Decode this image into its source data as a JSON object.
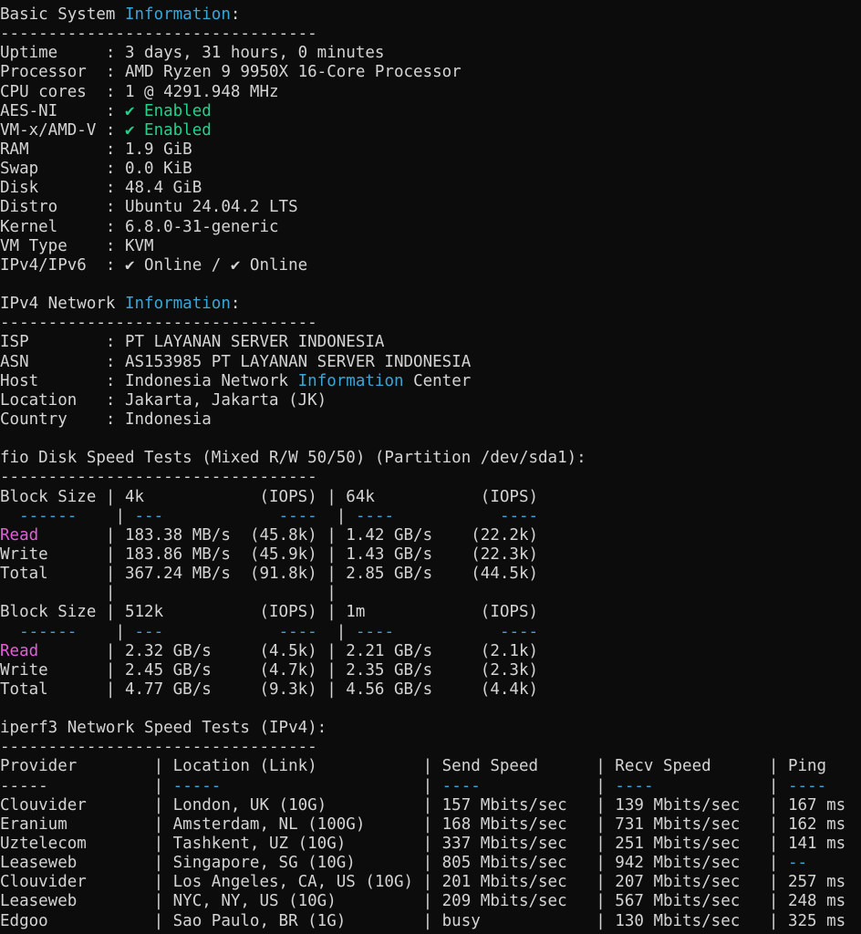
{
  "terminal": {
    "lines": [
      [
        [
          "Basic System ",
          "def"
        ],
        [
          "Information",
          "cyan"
        ],
        [
          ":",
          "def"
        ]
      ],
      [
        [
          "---------------------------------",
          "def"
        ]
      ],
      [
        [
          "Uptime     : 3 days, 31 hours, 0 minutes",
          "def"
        ]
      ],
      [
        [
          "Processor  : AMD Ryzen 9 9950X 16-Core Processor",
          "def"
        ]
      ],
      [
        [
          "CPU cores  : 1 @ 4291.948 MHz",
          "def"
        ]
      ],
      [
        [
          "AES-NI     : ",
          "def"
        ],
        [
          "✔ Enabled",
          "green"
        ]
      ],
      [
        [
          "VM-x/AMD-V : ",
          "def"
        ],
        [
          "✔ Enabled",
          "green"
        ]
      ],
      [
        [
          "RAM        : 1.9 GiB",
          "def"
        ]
      ],
      [
        [
          "Swap       : 0.0 KiB",
          "def"
        ]
      ],
      [
        [
          "Disk       : 48.4 GiB",
          "def"
        ]
      ],
      [
        [
          "Distro     : Ubuntu 24.04.2 LTS",
          "def"
        ]
      ],
      [
        [
          "Kernel     : 6.8.0-31-generic",
          "def"
        ]
      ],
      [
        [
          "VM Type    : KVM",
          "def"
        ]
      ],
      [
        [
          "IPv4/IPv6  : ✔ Online / ✔ Online",
          "def"
        ]
      ],
      [
        [
          "",
          "def"
        ]
      ],
      [
        [
          "IPv4 Network ",
          "def"
        ],
        [
          "Information",
          "cyan"
        ],
        [
          ":",
          "def"
        ]
      ],
      [
        [
          "---------------------------------",
          "def"
        ]
      ],
      [
        [
          "ISP        : PT LAYANAN SERVER INDONESIA",
          "def"
        ]
      ],
      [
        [
          "ASN        : AS153985 PT LAYANAN SERVER INDONESIA",
          "def"
        ]
      ],
      [
        [
          "Host       : Indonesia Network ",
          "def"
        ],
        [
          "Information",
          "cyan"
        ],
        [
          " Center",
          "def"
        ]
      ],
      [
        [
          "Location   : Jakarta, Jakarta (JK)",
          "def"
        ]
      ],
      [
        [
          "Country    : Indonesia",
          "def"
        ]
      ],
      [
        [
          "",
          "def"
        ]
      ],
      [
        [
          "fio Disk Speed Tests (Mixed R/W 50/50) (Partition /dev/sda1):",
          "def"
        ]
      ],
      [
        [
          "---------------------------------",
          "def"
        ]
      ],
      [
        [
          "Block Size | 4k            (IOPS) | 64k           (IOPS)",
          "def"
        ]
      ],
      [
        [
          "  ",
          "def"
        ],
        [
          "------",
          "cyan"
        ],
        [
          "    | ",
          "def"
        ],
        [
          "---",
          "cyan"
        ],
        [
          "            ",
          "def"
        ],
        [
          "----",
          "cyan"
        ],
        [
          "  | ",
          "def"
        ],
        [
          "----",
          "cyan"
        ],
        [
          "           ",
          "def"
        ],
        [
          "----",
          "cyan"
        ]
      ],
      [
        [
          "Read",
          "magenta"
        ],
        [
          "       | 183.38 MB/s  (45.8k) | 1.42 GB/s    (22.2k)",
          "def"
        ]
      ],
      [
        [
          "Write      | 183.86 MB/s  (45.9k) | 1.43 GB/s    (22.3k)",
          "def"
        ]
      ],
      [
        [
          "Total      | 367.24 MB/s  (91.8k) | 2.85 GB/s    (44.5k)",
          "def"
        ]
      ],
      [
        [
          "           |                      |",
          "def"
        ]
      ],
      [
        [
          "Block Size | 512k          (IOPS) | 1m            (IOPS)",
          "def"
        ]
      ],
      [
        [
          "  ",
          "def"
        ],
        [
          "------",
          "cyan"
        ],
        [
          "    | ",
          "def"
        ],
        [
          "---",
          "cyan"
        ],
        [
          "            ",
          "def"
        ],
        [
          "----",
          "cyan"
        ],
        [
          "  | ",
          "def"
        ],
        [
          "----",
          "cyan"
        ],
        [
          "           ",
          "def"
        ],
        [
          "----",
          "cyan"
        ]
      ],
      [
        [
          "Read",
          "magenta"
        ],
        [
          "       | 2.32 GB/s     (4.5k) | 2.21 GB/s     (2.1k)",
          "def"
        ]
      ],
      [
        [
          "Write      | 2.45 GB/s     (4.7k) | 2.35 GB/s     (2.3k)",
          "def"
        ]
      ],
      [
        [
          "Total      | 4.77 GB/s     (9.3k) | 4.56 GB/s     (4.4k)",
          "def"
        ]
      ],
      [
        [
          "",
          "def"
        ]
      ],
      [
        [
          "iperf3 Network Speed Tests (IPv4):",
          "def"
        ]
      ],
      [
        [
          "---------------------------------",
          "def"
        ]
      ],
      [
        [
          "Provider        | Location (Link)           | Send Speed      | Recv Speed      | Ping",
          "def"
        ]
      ],
      [
        [
          "-----           | ",
          "def"
        ],
        [
          "-----",
          "cyan"
        ],
        [
          "                     | ",
          "def"
        ],
        [
          "----",
          "cyan"
        ],
        [
          "            | ",
          "def"
        ],
        [
          "----",
          "cyan"
        ],
        [
          "            | ",
          "def"
        ],
        [
          "----",
          "cyan"
        ]
      ],
      [
        [
          "Clouvider       | London, UK (10G)          | 157 Mbits/sec   | 139 Mbits/sec   | 167 ms",
          "def"
        ]
      ],
      [
        [
          "Eranium         | Amsterdam, NL (100G)      | 168 Mbits/sec   | 731 Mbits/sec   | 162 ms",
          "def"
        ]
      ],
      [
        [
          "Uztelecom       | Tashkent, UZ (10G)        | 337 Mbits/sec   | 251 Mbits/sec   | 141 ms",
          "def"
        ]
      ],
      [
        [
          "Leaseweb        | Singapore, SG (10G)       | 805 Mbits/sec   | 942 Mbits/sec   | ",
          "def"
        ],
        [
          "--",
          "cyan"
        ]
      ],
      [
        [
          "Clouvider       | Los Angeles, CA, US (10G) | 201 Mbits/sec   | 207 Mbits/sec   | 257 ms",
          "def"
        ]
      ],
      [
        [
          "Leaseweb        | NYC, NY, US (10G)         | 209 Mbits/sec   | 567 Mbits/sec   | 248 ms",
          "def"
        ]
      ],
      [
        [
          "Edgoo           | Sao Paulo, BR (1G)        | busy            | 130 Mbits/sec   | 325 ms",
          "def"
        ]
      ]
    ]
  },
  "colors": {
    "background": "#0c0c0c",
    "text": "#d4d4d4",
    "cyan": "#3aa6d6",
    "green": "#23d18b",
    "magenta": "#e35ddb"
  }
}
